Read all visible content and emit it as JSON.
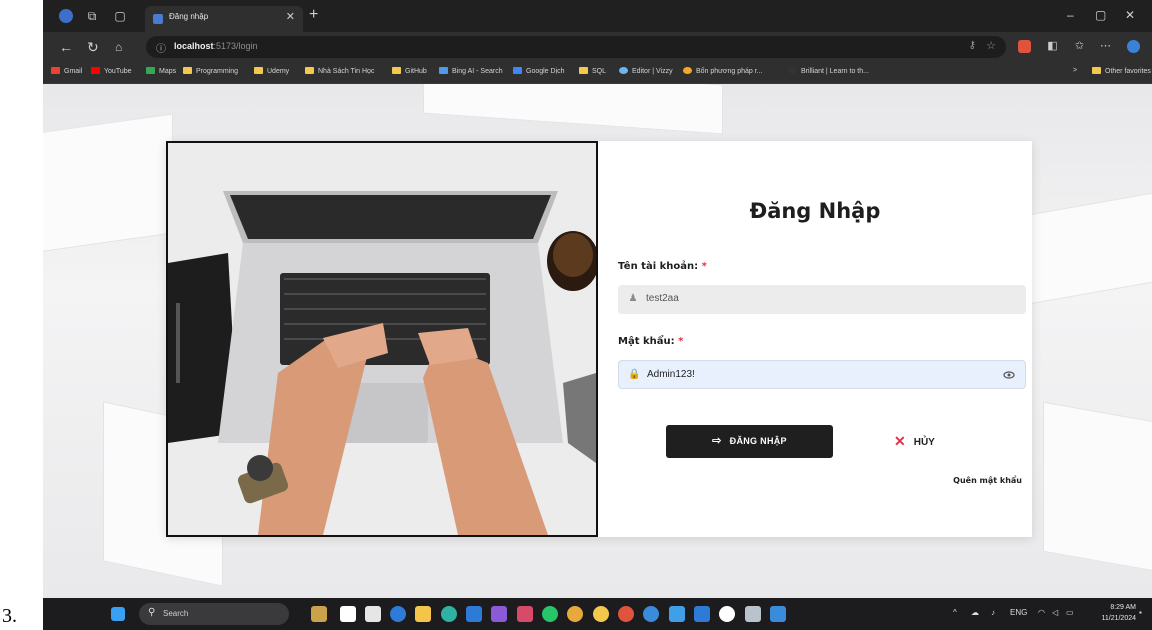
{
  "doc_number": "3.",
  "browser": {
    "tab_title": "Đăng nhập",
    "new_tab_symbol": "+",
    "url_host": "localhost",
    "url_path": ":5173/login",
    "bookmarks": [
      {
        "label": "Gmail",
        "color": "#ea4335"
      },
      {
        "label": "YouTube",
        "color": "#ff0000"
      },
      {
        "label": "Maps",
        "color": "#34a853"
      },
      {
        "label": "Programming",
        "color": "#f2c94c"
      },
      {
        "label": "Udemy",
        "color": "#f2c94c"
      },
      {
        "label": "Nhà Sách Tin Học",
        "color": "#f2c94c"
      },
      {
        "label": "GitHub",
        "color": "#f2c94c"
      },
      {
        "label": "Bing AI - Search",
        "color": "#4f9bea"
      },
      {
        "label": "Google Dịch",
        "color": "#4285f4"
      },
      {
        "label": "SQL",
        "color": "#f2c94c"
      },
      {
        "label": "Editor | Vizzy",
        "color": "#6fb3f0"
      },
      {
        "label": "Bốn phương pháp r...",
        "color": "#f0a830"
      },
      {
        "label": "Brilliant | Learn to th...",
        "color": "#333333"
      }
    ],
    "bookmarks_overflow": ">",
    "other_favorites": "Other favorites"
  },
  "login": {
    "title": "Đăng Nhập",
    "username_label": "Tên tài khoản:",
    "username_value": "test2aa",
    "password_label": "Mật khẩu:",
    "password_value": "Admin123!",
    "required_mark": "*",
    "login_button": "ĐĂNG NHẬP",
    "cancel_button": "HỦY",
    "forgot_link": "Quên mật khẩu"
  },
  "taskbar": {
    "search_label": "Search",
    "lang": "ENG",
    "time": "8:29 AM",
    "date": "11/21/2024"
  },
  "colors": {
    "required": "#e0324a",
    "button_dark": "#1f1f1f",
    "password_bg": "#e8f0fe"
  }
}
